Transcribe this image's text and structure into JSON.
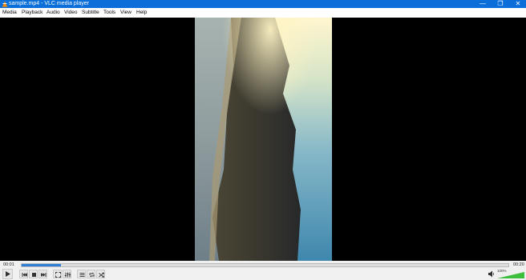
{
  "window": {
    "title": "sample.mp4 - VLC media player",
    "minimize_glyph": "—",
    "maximize_glyph": "❐",
    "close_glyph": "✕"
  },
  "menu": [
    "Media",
    "Playback",
    "Audio",
    "Video",
    "Subtitle",
    "Tools",
    "View",
    "Help"
  ],
  "player": {
    "time_elapsed": "00:01",
    "time_total": "00:20",
    "progress": 0.08,
    "volume_text": "100%",
    "volume_level": 1.0,
    "accent_color": "#2f7fd6",
    "volume_color": "#3cbf3c"
  },
  "icons": [
    "vlc-cone-icon",
    "play-icon",
    "previous-icon",
    "stop-icon",
    "next-icon",
    "fullscreen-icon",
    "extended-settings-icon",
    "playlist-icon",
    "loop-icon",
    "shuffle-icon",
    "speaker-icon"
  ]
}
